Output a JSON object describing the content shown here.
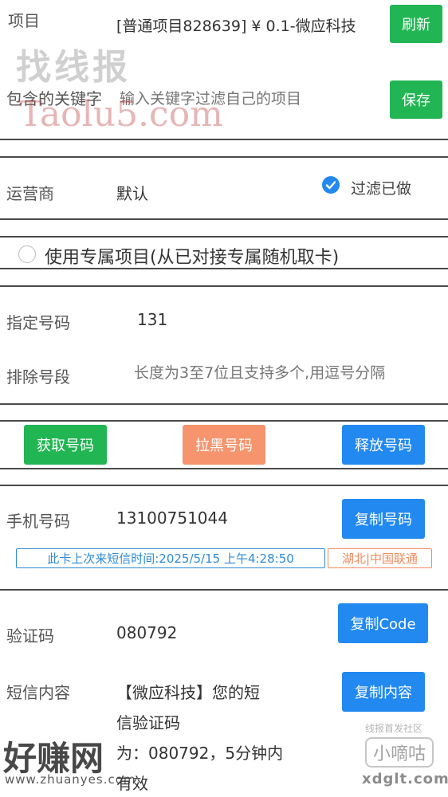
{
  "project": {
    "label": "项目",
    "value": "[普通项目828639] ¥ 0.1-微应科技",
    "refresh_label": "刷新"
  },
  "keyword": {
    "label": "包含的关键字",
    "placeholder": "输入关键字过滤自己的项目",
    "save_label": "保存"
  },
  "operator": {
    "label": "运营商",
    "value": "默认",
    "filter_label": "过滤已做",
    "filter_checked": true
  },
  "exclusive": {
    "label": "使用专属项目(从已对接专属随机取卡)",
    "checked": false
  },
  "number": {
    "specify_label": "指定号码",
    "specify_value": "131",
    "exclude_label": "排除号段",
    "exclude_placeholder": "长度为3至7位且支持多个,用逗号分隔"
  },
  "actions": {
    "get_label": "获取号码",
    "block_label": "拉黑号码",
    "release_label": "释放号码"
  },
  "phone": {
    "label": "手机号码",
    "value": "13100751044",
    "copy_label": "复制号码",
    "last_sms_text": "此卡上次来短信时间:2025/5/15 上午4:28:50",
    "location_text": "湖北|中国联通"
  },
  "code": {
    "label": "验证码",
    "value": "080792",
    "copy_label": "复制Code"
  },
  "sms": {
    "label": "短信内容",
    "line1": "【微应科技】您的短",
    "line2": "信验证码",
    "line3": "为：080792，5分钟内",
    "line4": "有效",
    "copy_label": "复制内容"
  },
  "watermarks": {
    "top_cn": "找线报",
    "top_en": "Taolu5.com",
    "bottom_cn": "好赚网",
    "bottom_url": "www.zhuanyes.com",
    "right_small": "线报首发社区",
    "right_cn": "小嘀咕",
    "right_url": "xdglt.com"
  },
  "colors": {
    "green": "#22b554",
    "orange": "#f5946d",
    "blue": "#2289f0",
    "accent_text": "#2e8bd6",
    "location_text": "#f08a5d"
  }
}
